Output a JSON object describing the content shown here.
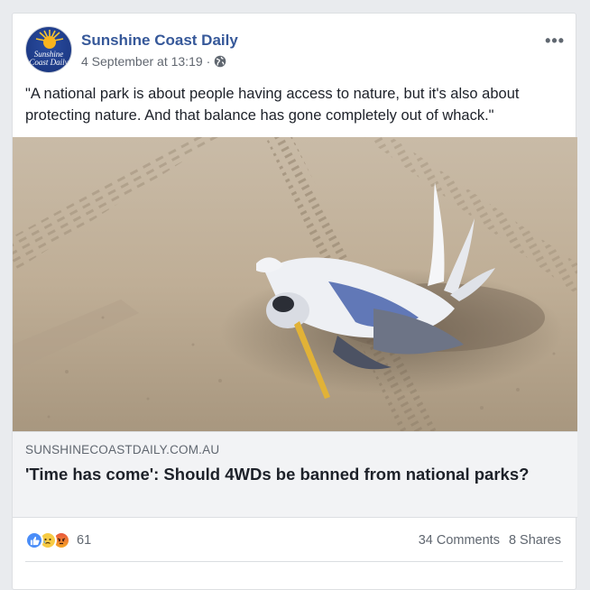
{
  "post": {
    "page_name": "Sunshine Coast Daily",
    "avatar_text_line1": "Sunshine",
    "avatar_text_line2": "Coast Daily",
    "timestamp": "4 September at 13:19",
    "separator": "·",
    "privacy_icon": "globe-icon",
    "more_icon": "more-options-icon",
    "more_label": "•••",
    "text": "\"A national park is about people having access to nature, but it's also about protecting nature. And that balance has gone completely out of whack.\""
  },
  "link_preview": {
    "image_description_icon": "dead-bird-on-beach-photo",
    "domain": "SUNSHINECOASTDAILY.COM.AU",
    "title": "'Time has come': Should 4WDs be banned from national parks?"
  },
  "engagement": {
    "reactions": [
      "like",
      "sad",
      "angry"
    ],
    "reaction_count": "61",
    "comments": "34 Comments",
    "shares": "8 Shares"
  },
  "colors": {
    "page_name": "#365899",
    "link_bg": "#f2f3f5",
    "like": "#4a8df8"
  }
}
